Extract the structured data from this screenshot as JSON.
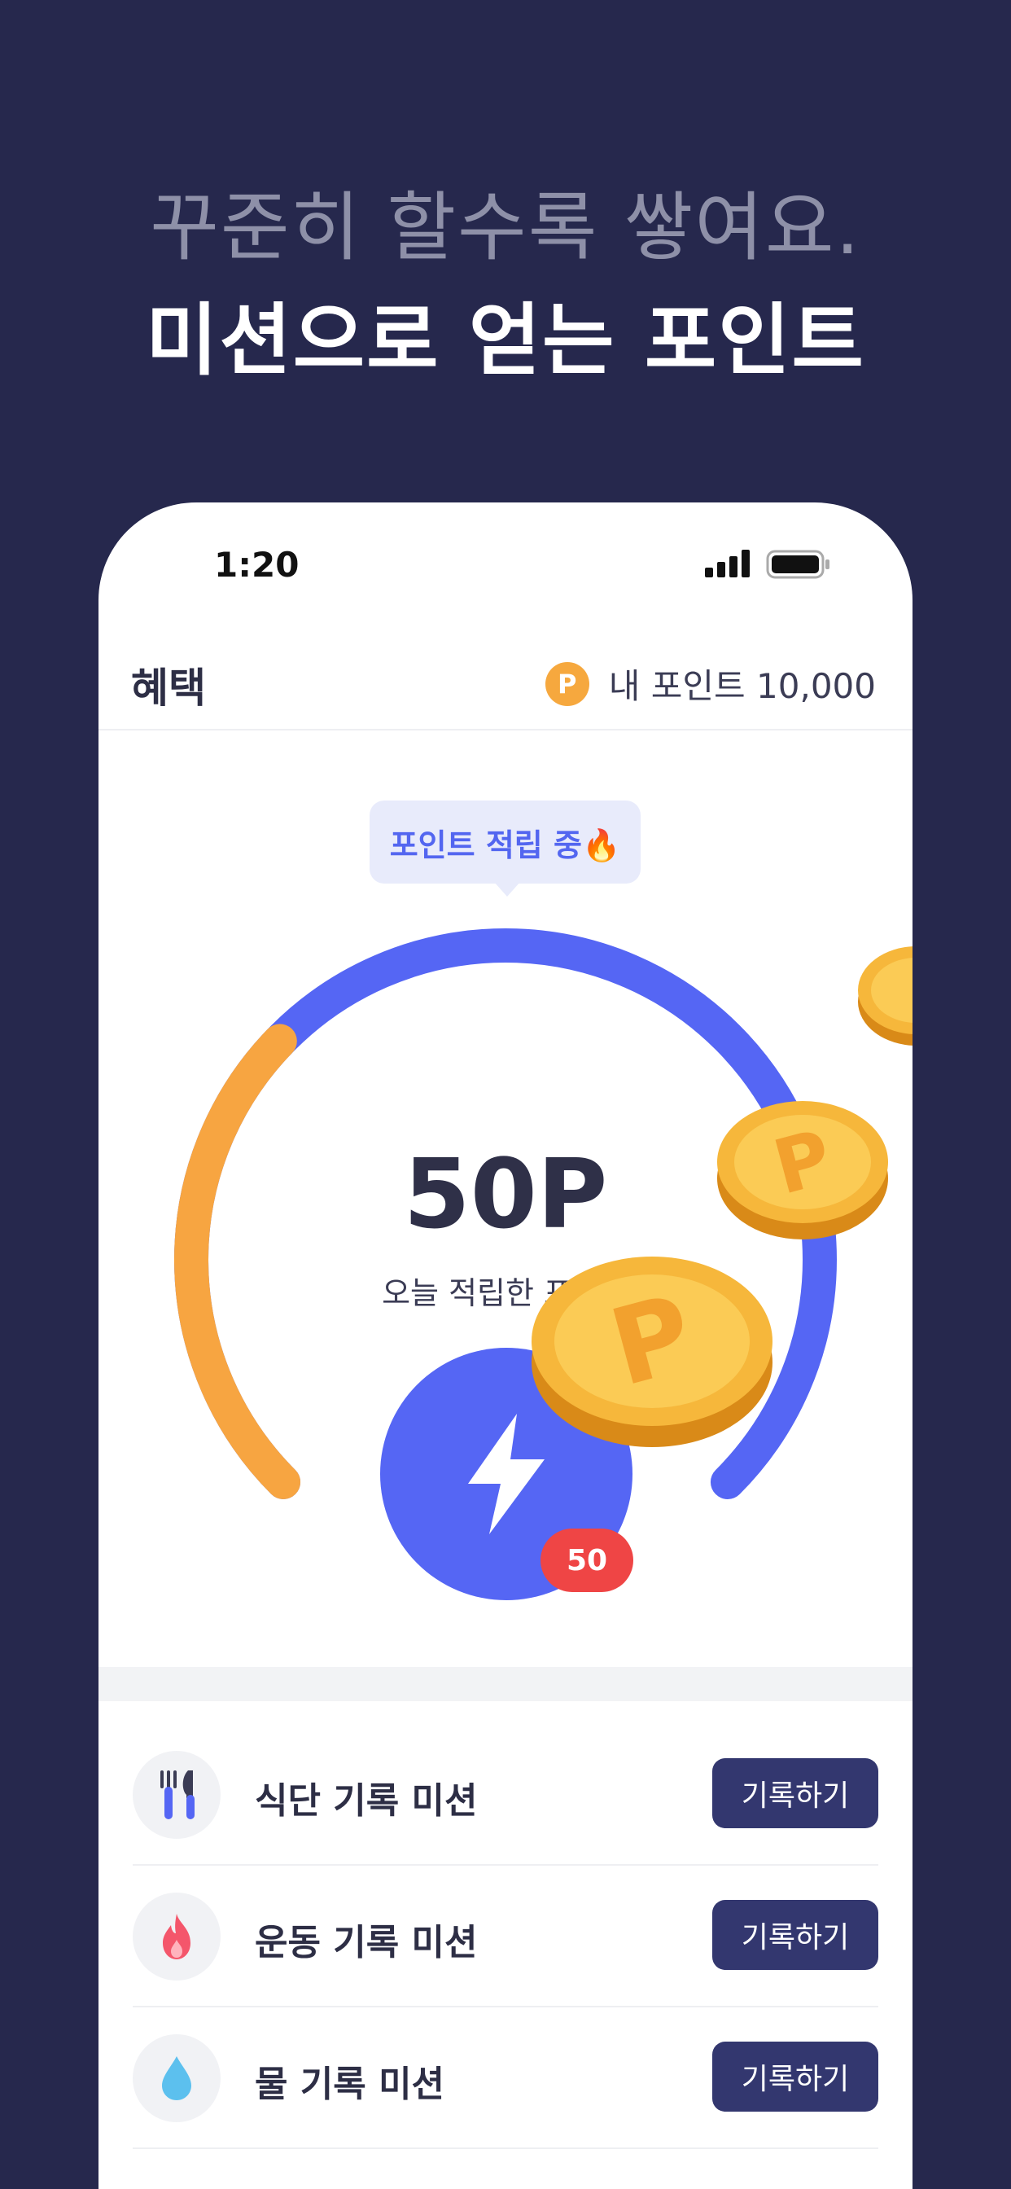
{
  "promo": {
    "line1": "꾸준히 할수록 쌓여요.",
    "line2": "미션으로 얻는 포인트"
  },
  "status_bar": {
    "time": "1:20"
  },
  "header": {
    "title": "혜택",
    "point_icon_letter": "P",
    "points_label": "내 포인트 10,000"
  },
  "gauge": {
    "bubble_text": "포인트 적립 중🔥",
    "amount": "50P",
    "caption": "오늘 적립한 포인트",
    "badge_count": "50",
    "progress_fraction": 0.33,
    "colors": {
      "progress": "#f7a541",
      "track": "#5566f4"
    }
  },
  "missions": [
    {
      "label": "식단 기록 미션",
      "button": "기록하기",
      "icon": "fork-knife-icon"
    },
    {
      "label": "운동 기록 미션",
      "button": "기록하기",
      "icon": "fire-icon"
    },
    {
      "label": "물 기록 미션",
      "button": "기록하기",
      "icon": "water-drop-icon"
    }
  ],
  "colors": {
    "background": "#26284d",
    "accent": "#5566f4",
    "button": "#33376f",
    "badge": "#ef4545",
    "coin": "#f6a83e"
  }
}
